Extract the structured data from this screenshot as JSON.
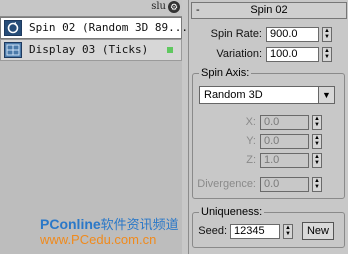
{
  "left": {
    "header_text": "slu",
    "corner_icon": "gear-icon",
    "events": [
      {
        "label": "Spin 02 (Random 3D 89...",
        "icon": "spin-icon"
      },
      {
        "label": "Display 03 (Ticks)",
        "icon": "display-icon"
      }
    ],
    "watermark": {
      "line1_brand": "PConline",
      "line1_rest": "软件资讯频道",
      "line2": "www.PCedu.com.cn"
    }
  },
  "rollout": {
    "title": "Spin 02",
    "collapse_symbol": "-",
    "spin_rate": {
      "label": "Spin Rate:",
      "value": "900.0"
    },
    "variation": {
      "label": "Variation:",
      "value": "100.0"
    },
    "spin_axis": {
      "group_label": "Spin Axis:",
      "selected": "Random 3D",
      "x": {
        "label": "X:",
        "value": "0.0"
      },
      "y": {
        "label": "Y:",
        "value": "0.0"
      },
      "z": {
        "label": "Z:",
        "value": "1.0"
      },
      "divergence": {
        "label": "Divergence:",
        "value": "0.0"
      }
    },
    "uniqueness": {
      "group_label": "Uniqueness:",
      "seed_label": "Seed:",
      "seed_value": "12345",
      "new_label": "New"
    }
  },
  "colors": {
    "accent": "#2a78c8",
    "status_green": "#5fc85f"
  }
}
